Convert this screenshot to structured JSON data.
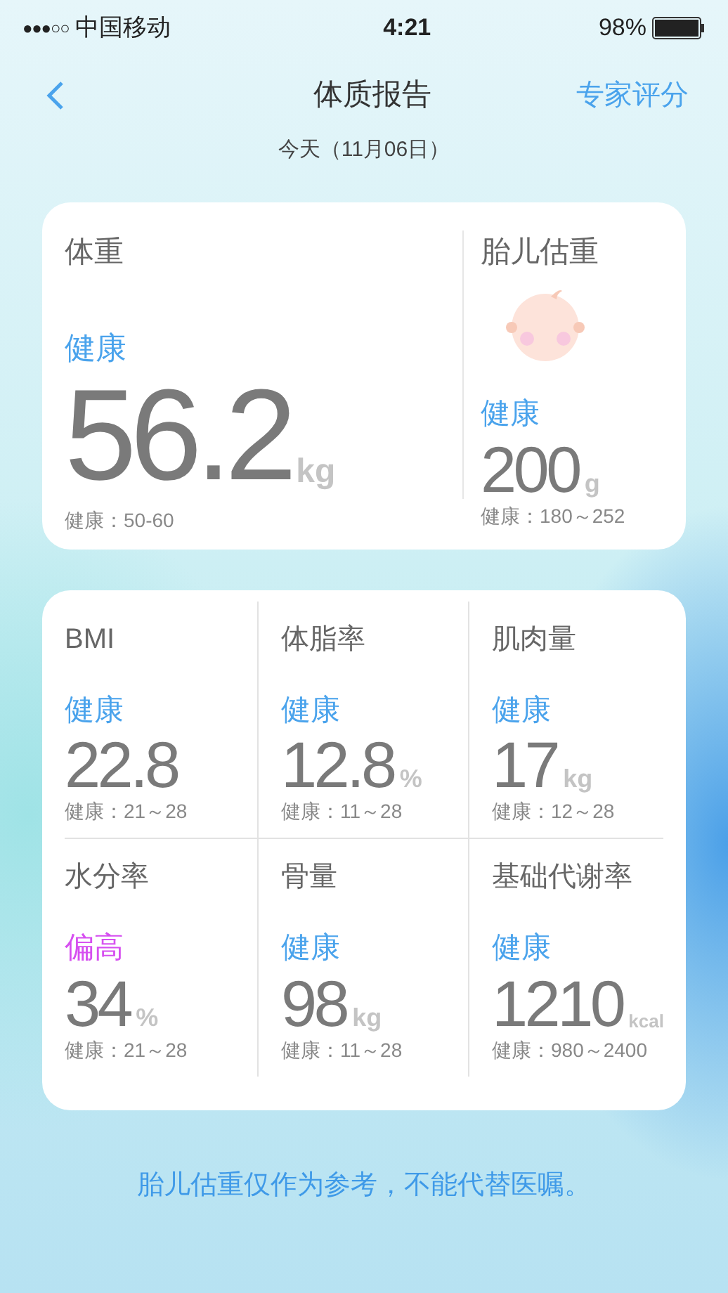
{
  "status_bar": {
    "signal": "●●●○○",
    "carrier": "中国移动",
    "time": "4:21",
    "battery": "98%"
  },
  "nav": {
    "title": "体质报告",
    "action": "专家评分",
    "date": "今天（11月06日）"
  },
  "weight": {
    "label": "体重",
    "status": "健康",
    "color": "#4aa3ec",
    "value": "56.2",
    "unit": "kg",
    "range": "健康：50-60"
  },
  "fetal": {
    "label": "胎儿估重",
    "status": "健康",
    "color": "#4aa3ec",
    "value": "200",
    "unit": "g",
    "range": "健康：180～252"
  },
  "metrics": [
    {
      "label": "BMI",
      "status": "健康",
      "color": "#4aa3ec",
      "value": "22.8",
      "range": "健康：21～28"
    },
    {
      "label": "体脂率",
      "status": "健康",
      "color": "#4aa3ec",
      "value": "12.8",
      "unit": "%",
      "range": "健康：11～28"
    },
    {
      "label": "肌肉量",
      "status": "健康",
      "color": "#4aa3ec",
      "value": "17",
      "unit": "kg",
      "range": "健康：12～28"
    },
    {
      "label": "水分率",
      "status": "偏高",
      "color": "#d64ff0",
      "value": "34",
      "unit": "%",
      "range": "健康：21～28"
    },
    {
      "label": "骨量",
      "status": "健康",
      "color": "#4aa3ec",
      "value": "98",
      "unit": "kg",
      "range": "健康：11～28"
    },
    {
      "label": "基础代谢率",
      "status": "健康",
      "color": "#4aa3ec",
      "value": "1210",
      "unit": "kcal",
      "range": "健康：980～2400"
    }
  ],
  "footer": "胎儿估重仅作为参考，不能代替医嘱。"
}
